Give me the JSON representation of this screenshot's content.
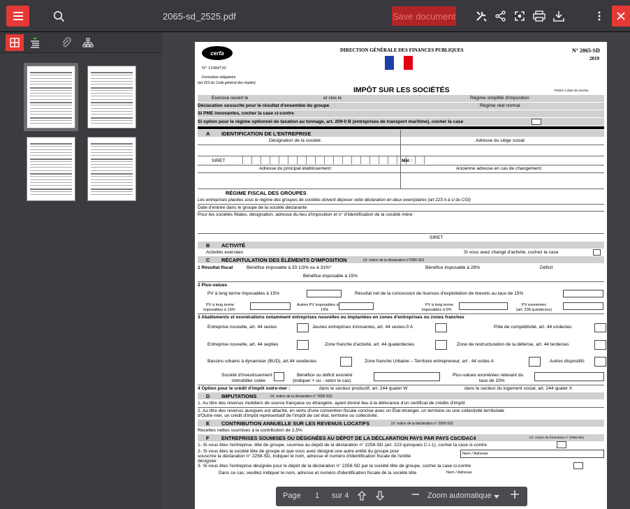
{
  "toolbar": {
    "filename": "2065-sd_2525.pdf",
    "save_label": "Save document",
    "colors": {
      "accent": "#e53935",
      "toolbar_bg": "#38383d"
    }
  },
  "sidebar": {
    "tools": [
      "thumbnails-icon",
      "outline-icon",
      "attachments-icon",
      "layers-icon"
    ],
    "thumbnail_count": 4
  },
  "pager": {
    "page_label": "Page",
    "page_value": "1",
    "of_label": "sur 4",
    "zoom_label": "Zoom automatique"
  },
  "doc": {
    "cerfa": "cerfa",
    "dgfip": "DIRECTION GÉNÉRALE DES FINANCES PUBLIQUES",
    "form_no": "N° 2065-SD",
    "year": "2019",
    "cerfa_no": "N° 11084*20",
    "oblig": "Formulaire obligatoire",
    "cgi": "(art 223 du Code général des impôts)",
    "main_title": "IMPÔT SUR LES SOCIÉTÉS",
    "timbre": "Timbre à date du service",
    "exercice": "Exercice ouvert le",
    "clos": "et clos le",
    "regime_simpl": "Régime simplifié d'imposition",
    "decl_groupe": "Déclaration souscrite pour le résultat d'ensemble du groupe",
    "regime_reel": "Régime réel normal",
    "pme": "Si PME innovantes, cocher la case ci-contre",
    "tonnage": "Si option pour le régime optionnel de taxation au tonnage, art. 209-0 B (entreprises de transport maritime), cocher la case",
    "secA_letter": "A",
    "secA": "IDENTIFICATION DE L'ENTREPRISE",
    "designation": "Désignation de la société:",
    "adresse_siege": "Adresse du siège social:",
    "siret": "SIRET",
    "mel": "Mél :",
    "adresse_principal": "Adresse du principal établissement:",
    "ancienne_adresse": "Ancienne adresse en cas de changement:",
    "regime_groupes": "RÉGIME FISCAL DES GROUPES",
    "groupes_note": "Les entreprises placées sous le régime des groupes de sociétés doivent déposer cette déclaration en deux exemplaires (art 223 A à U du CGI)",
    "date_entree": "Date d'entrée dans le groupe de la société déclarante",
    "filiales": "Pour les sociétés filiales, désignation, adresse du lieu d'imposition et n° d'identification de la société mère:",
    "siret2": "SIRET",
    "secB_letter": "B",
    "secB": "ACTIVITÉ",
    "activites": "Activités exercées",
    "chg_activite": "Si vous avez changé d'activité, cochez la case",
    "secC_letter": "C",
    "secC": "RÉCAPITULATION DES ÉLÉMENTS D'IMPOSITION",
    "secC_note": "(cf. notice de la déclaration n°2065-SD)",
    "res_fiscal": "1 Résultat fiscal",
    "benef_33": "Bénéfice imposable à 33 1/3% ou à 31%*",
    "benef_28": "Bénéfice imposable à 28%",
    "deficit": "Déficit",
    "benef_15": "Bénéfice imposable à 15%",
    "plus_values": "2 Plus-values",
    "pv_lt_15": "PV à long terme imposables à 15%",
    "licences": "Résultat net de la concession de licences d'exploitation de brevets au taux de 15%",
    "pv_lt_19a": "PV à long terme",
    "pv_lt_19b": "imposables à 19%",
    "autres_pv_a": "Autres PV imposables à",
    "autres_pv_b": "19%",
    "pv_lt_0a": "PV à long terme",
    "pv_lt_0b": "imposables à 0%",
    "pv_exo_a": "PV exonérées",
    "pv_exo_b": "(art. 238 quindecies)",
    "abattements": "3 Abattements et exonérations notamment entreprises nouvelles ou implantées en zones d'entreprises ou zones franches",
    "ent_nouv_sexies": "Entreprise nouvelle, art. 44 sexies",
    "jeunes_ent": "Jeunes entreprises innovantes, art. 44 sexies-0 A",
    "pole_compet": "Pôle de compétitivité, art. 44 undecies",
    "ent_nouv_septies": "Entreprise nouvelle, art. 44 septies",
    "zone_franche": "Zone franche d'activité, art. 44 quaterdecies",
    "zone_restruct": "Zone de restructuration de la défense, art. 44 terdecies",
    "bassins": "Bassins urbains à dynamiser (BUD), art.44 sexdecies",
    "zfu": "Zone franche Urbaine – Territoire entrepreneur, art . 44 octies A",
    "autres_disp": "Autres dispositifs",
    "soc_invest_a": "Société d'investissement",
    "soc_invest_b": "immobilier cotée",
    "benef_exo_a": "Bénéfice ou déficit exonéré",
    "benef_exo_b": "(indiquer + ou - selon le cas)",
    "pv_exo15_a": "Plus-values exonérées relevant du",
    "pv_exo15_b": "taux de 15%",
    "outremer": "4 Option pour le crédit d'impôt outre-mer :",
    "outremer_prod": "dans le secteur productif, art. 244 quater W",
    "outremer_log": "dans le secteur du logement social, art. 244 quater X",
    "secD_letter": "D",
    "secD": "IMPUTATIONS",
    "secD_note": "(cf. notice de la déclaration n° 2065-SD)",
    "imput1": "1. Au titre des revenus mobiliers de source française ou étrangère, ayant donné lieu à la délivrance d'un certificat de crédits d'impôt",
    "imput2a": "2. Au titre des revenus auxquels est attaché, en vertu d'une convention fiscale conclue avec un État étranger, un territoire ou une collectivité territoriale",
    "imput2b": "d'Outre-mer, un crédit d'impôt représentatif de l'impôt de cet état, territoire ou collectivité.",
    "secE_letter": "E",
    "secE": "CONTRIBUTION ANNUELLE SUR LES REVENUS LOCATIFS",
    "secE_note": "(cf. notice de la déclaration n° 2065-SD)",
    "recettes": "Recettes nettes soumises à la contribution de 2,5%",
    "secF_letter": "F",
    "secF": "ENTREPRISES SOUMISES OU DÉSIGNÉES AU DÉPOT DE LA DÉCLARATION PAYS PAR PAYS CbC/DAC4",
    "secF_note": "(cf. notice du formulaire n° 2065-SD)",
    "f1": "1- Si vous êtes l'entreprise, tête de groupe, soumise au dépôt de la déclaration n° 2258-SD (art. 223 quinquies C-I-1), cocher la case ci-contre",
    "f2a": "2- Si vous êtes la société tête de groupe et que vous avez désigné une autre entité du groupe pour",
    "f2b": "souscrire la déclaration n° 2258-SD, indiquer le nom, adresse et numéro d'identification fiscale de l'entité",
    "f2c": "désignée",
    "nom_adresse": "Nom / Adresse",
    "f3": "3- Si vous êtes l'entreprise désignée pour le dépôt de la déclaration n° 2258-SD par la société tête de groupe, cocher la case ci-contre",
    "f3b": "Dans ce cas, veuillez indiquer le nom, adresse et numéro d'identification fiscale de la société tête",
    "nom_adresse2": "Nom / Adresse"
  }
}
